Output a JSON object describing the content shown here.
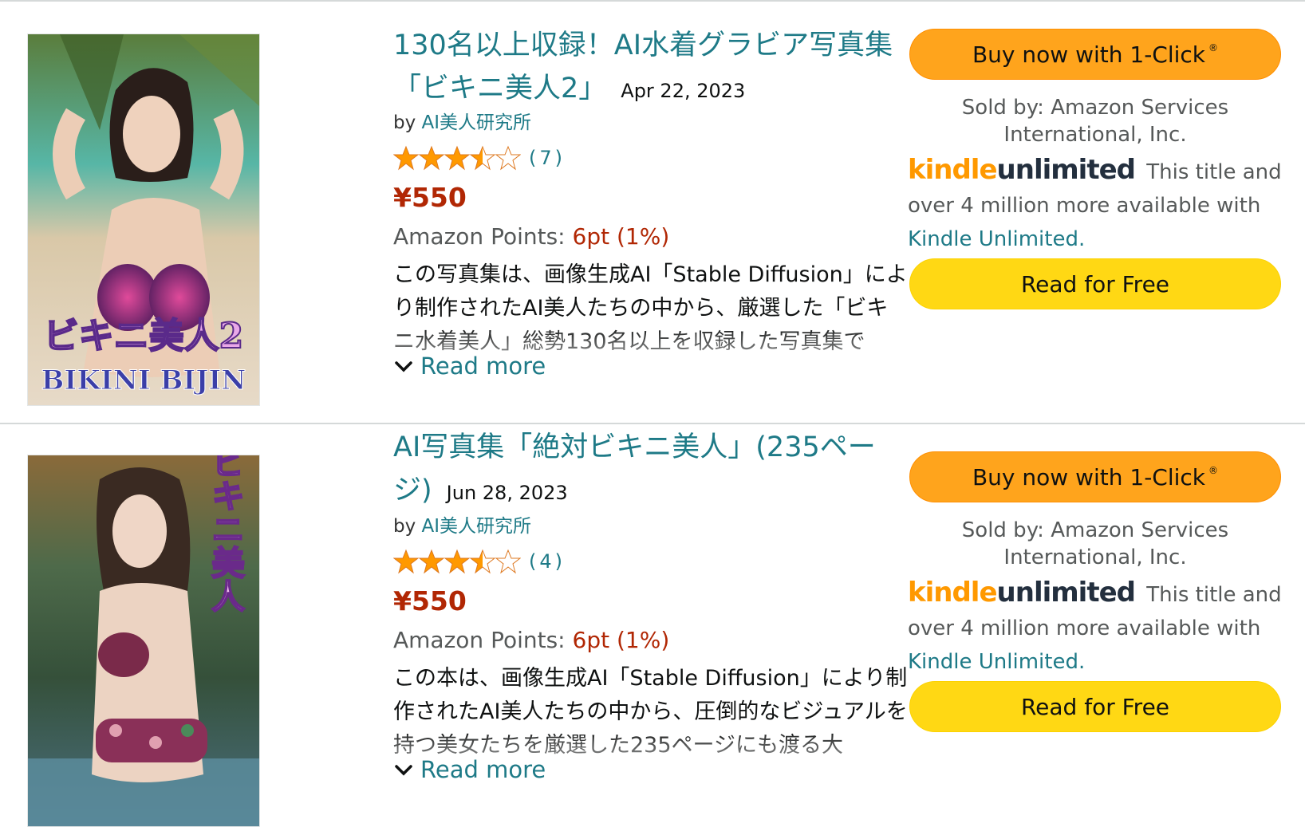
{
  "items": [
    {
      "title": "130名以上収録！AI水着グラビア写真集「ビキニ美人2」",
      "date": "Apr 22, 2023",
      "by_prefix": "by",
      "author": "AI美人研究所",
      "rating": 3.5,
      "rating_count": "(7)",
      "price": "¥550",
      "points_label": "Amazon Points:",
      "points_value": "6pt",
      "points_percent": "(1%)",
      "description": "この写真集は、画像生成AI「Stable Diffusion」により制作されたAI美人たちの中から、厳選した「ビキニ水着美人」総勢130名以上を収録した写真集で",
      "read_more": "Read more",
      "buy_label": "Buy now with 1-Click",
      "buy_mark": "®",
      "sold_by": "Sold by: Amazon Services International, Inc.",
      "ku_logo_kindle": "kindle",
      "ku_logo_unlimited": "unlimited",
      "ku_text": "This title and over 4 million more available with",
      "ku_link": "Kindle Unlimited.",
      "read_free": "Read for Free",
      "cover_text_1": "ビキニ美人2",
      "cover_text_2": "BIKINI BIJIN"
    },
    {
      "title": "AI写真集「絶対ビキニ美人」(235ページ)",
      "date": "Jun 28, 2023",
      "by_prefix": "by",
      "author": "AI美人研究所",
      "rating": 3.5,
      "rating_count": "(4)",
      "price": "¥550",
      "points_label": "Amazon Points:",
      "points_value": "6pt",
      "points_percent": "(1%)",
      "description": "この本は、画像生成AI「Stable Diffusion」により制作されたAI美人たちの中から、圧倒的なビジュアルを持つ美女たちを厳選した235ページにも渡る大",
      "read_more": "Read more",
      "buy_label": "Buy now with 1-Click",
      "buy_mark": "®",
      "sold_by": "Sold by: Amazon Services International, Inc.",
      "ku_logo_kindle": "kindle",
      "ku_logo_unlimited": "unlimited",
      "ku_text": "This title and over 4 million more available with",
      "ku_link": "Kindle Unlimited.",
      "read_free": "Read for Free",
      "cover_text_1": "絶対ビキニ美人"
    }
  ],
  "colors": {
    "link": "#1e7a87",
    "price": "#b12704",
    "star": "#ff9900",
    "buy_button": "#ffa41c",
    "free_button": "#ffd814",
    "ku_orange": "#ff9900"
  }
}
